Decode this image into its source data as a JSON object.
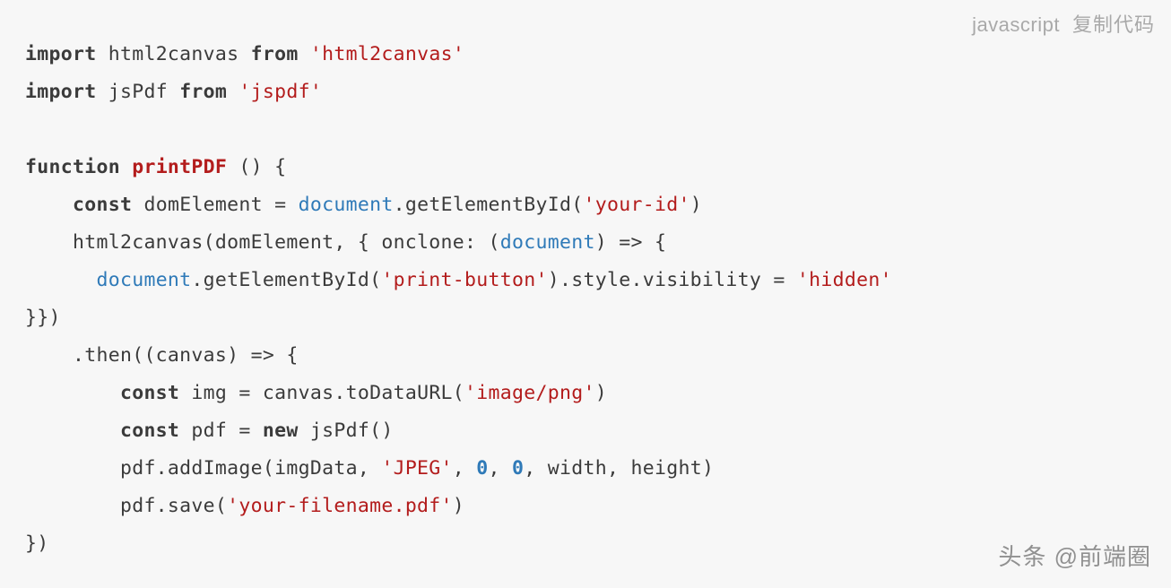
{
  "header": {
    "language": "javascript",
    "copy_label": "复制代码"
  },
  "code": {
    "line1_import": "import",
    "line1_html2canvas": " html2canvas ",
    "line1_from": "from",
    "line1_str": " 'html2canvas'",
    "line2_import": "import",
    "line2_jsPdf": " jsPdf ",
    "line2_from": "from",
    "line2_str": " 'jspdf'",
    "line4_function": "function",
    "line4_sp": " ",
    "line4_printPDF": "printPDF",
    "line4_rest": " () {",
    "line5_pre": "    ",
    "line5_const": "const",
    "line5_dom": " domElement = ",
    "line5_doc": "document",
    "line5_get": ".getElementById(",
    "line5_str": "'your-id'",
    "line5_close": ")",
    "line6": "    html2canvas(domElement, { onclone: (",
    "line6_doc": "document",
    "line6_arrow": ") => {",
    "line7_pre": "      ",
    "line7_doc": "document",
    "line7_get": ".getElementById(",
    "line7_str": "'print-button'",
    "line7_mid": ").style.visibility = ",
    "line7_str2": "'hidden'",
    "line8": "}})",
    "line9": "    .then((canvas) => {",
    "line10_pre": "        ",
    "line10_const": "const",
    "line10_img": " img = canvas.toDataURL(",
    "line10_str": "'image/png'",
    "line10_close": ")",
    "line11_pre": "        ",
    "line11_const": "const",
    "line11_pdf": " pdf = ",
    "line11_new": "new",
    "line11_rest": " jsPdf()",
    "line12_pre": "        pdf.addImage(imgData, ",
    "line12_str": "'JPEG'",
    "line12_mid": ", ",
    "line12_zero1": "0",
    "line12_mid2": ", ",
    "line12_zero2": "0",
    "line12_rest": ", width, height)",
    "line13_pre": "        pdf.save(",
    "line13_str": "'your-filename.pdf'",
    "line13_close": ")",
    "line14": "})"
  },
  "watermark": "头条 @前端圈"
}
